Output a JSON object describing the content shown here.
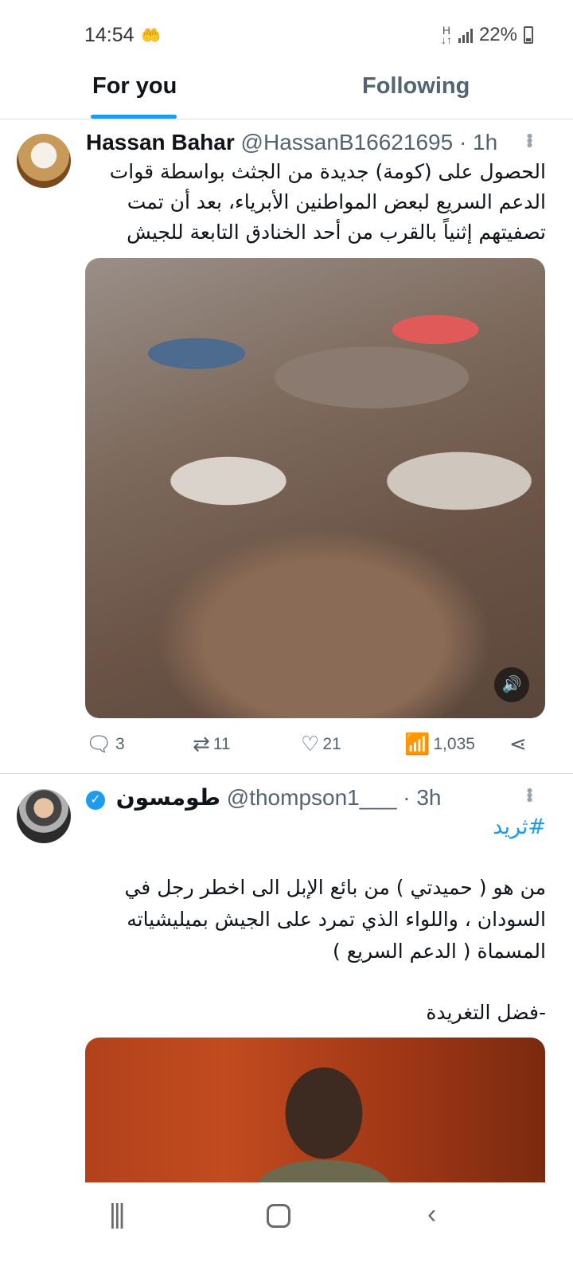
{
  "status_bar": {
    "time": "14:54",
    "time_icon": "🤲",
    "battery_percent": "22%",
    "data_icon_label": "H"
  },
  "tabs": [
    {
      "label": "For you",
      "active": true
    },
    {
      "label": "Following",
      "active": false
    }
  ],
  "tweets": [
    {
      "name": "Hassan Bahar",
      "handle": "@HassanB16621695",
      "time": "· 1h",
      "text": "الحصول على (كومة) جديدة من الجثث بواسطة قوات الدعم السريع لبعض المواطنين الأبرياء، بعد أن تمت تصفيتهم إثنياً بالقرب من أحد الخنادق التابعة للجيش",
      "media_sound_icon": "🔊",
      "actions": {
        "replies": "3",
        "retweets": "11",
        "likes": "21",
        "views": "1,035"
      }
    },
    {
      "name": "طومسون",
      "verified": true,
      "handle": "@thompson1___",
      "time": "· 3h",
      "hashtag": "#ثريد",
      "text": "من هو ( حميدتي ) من بائع الإبل الى اخطر رجل في السودان ، واللواء الذي تمرد على الجيش بميليشياته المسماة ( الدعم السريع )",
      "text2": "-فضل التغريدة"
    }
  ],
  "icons": {
    "reply": "reply-icon",
    "retweet": "retweet-icon",
    "like": "heart-icon",
    "views": "views-icon",
    "share": "share-icon",
    "more": "more-icon"
  },
  "colors": {
    "accent": "#1d9bf0",
    "text_primary": "#0f1419",
    "text_secondary": "#536471"
  }
}
